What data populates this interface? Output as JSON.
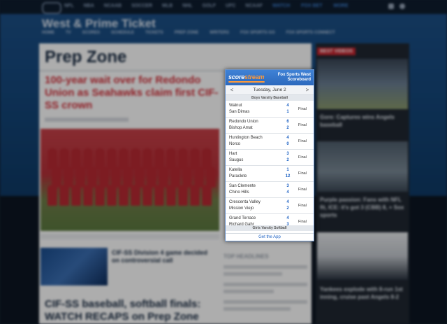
{
  "background_page": {
    "top_nav": [
      "NFL",
      "NBA",
      "NCAAB",
      "SOCCER",
      "MLB",
      "NHL",
      "GOLF",
      "UFC",
      "NCAAF"
    ],
    "top_nav_right": [
      "WATCH",
      "FOX BET",
      "MORE"
    ],
    "site_title": "West & Prime Ticket",
    "sub_nav": [
      "HOME",
      "TV",
      "SCORES",
      "SCHEDULE",
      "TICKETS",
      "PREP ZONE",
      "WRITERS",
      "FOX SPORTS GO",
      "FOX SPORTS CONNECT"
    ],
    "page_title": "Prep Zone",
    "headline": "100-year wait over for Redondo Union as Seahawks claim first CIF-SS crown",
    "secondary_headline": "CIF-SS Division 4 game decided on controversial call",
    "story_headline": "CIF-SS baseball, softball finals: WATCH RECAPS on Prep Zone",
    "mid_label": "TOP HEADLINES",
    "sidebar_tag": "BEST VIDEOS",
    "sidebar_stories": [
      "Gore: Captures wins Angels baseball",
      "Purple passion: Fans with NFL fit, ICE: it's got 3 (CBB) 8, + Sox sports",
      "Yankees explode with 8-run 1st inning, cruise past Angels 8-2"
    ]
  },
  "widget": {
    "logo_main": "score",
    "logo_accent": "stream",
    "brand_line1": "Fox Sports West",
    "brand_line2": "Scoreboard",
    "date": "Tuesday, June 2",
    "prev_arrow": "<",
    "next_arrow": ">",
    "section_top": "Boys Varsity Baseball",
    "section_bottom": "Girls Varsity Softball",
    "games": [
      {
        "team1": "Walnut",
        "score1": "4",
        "team2": "San Dimas",
        "score2": "1",
        "status": "Final"
      },
      {
        "team1": "Redondo Union",
        "score1": "6",
        "team2": "Bishop Amat",
        "score2": "2",
        "status": "Final"
      },
      {
        "team1": "Huntington Beach",
        "score1": "4",
        "team2": "Norco",
        "score2": "0",
        "status": "Final"
      },
      {
        "team1": "Hart",
        "score1": "3",
        "team2": "Saugus",
        "score2": "2",
        "status": "Final"
      },
      {
        "team1": "Katella",
        "score1": "1",
        "team2": "Paraclete",
        "score2": "12",
        "status": "Final"
      },
      {
        "team1": "San Clemente",
        "score1": "3",
        "team2": "Chino Hills",
        "score2": "4",
        "status": "Final"
      },
      {
        "team1": "Crescenta Valley",
        "score1": "4",
        "team2": "Mission Viejo",
        "score2": "2",
        "status": "Final"
      },
      {
        "team1": "Grand Terrace",
        "score1": "4",
        "team2": "Richard Gahr",
        "score2": "3",
        "status": "Final"
      }
    ],
    "get_app": "Get the App"
  },
  "colors": {
    "widget_header": "#2c69bd",
    "score_blue": "#1f63c4",
    "logo_accent": "#ff9a3a",
    "headline_red": "#d4303a",
    "hero_blue": "#1c4f86"
  }
}
